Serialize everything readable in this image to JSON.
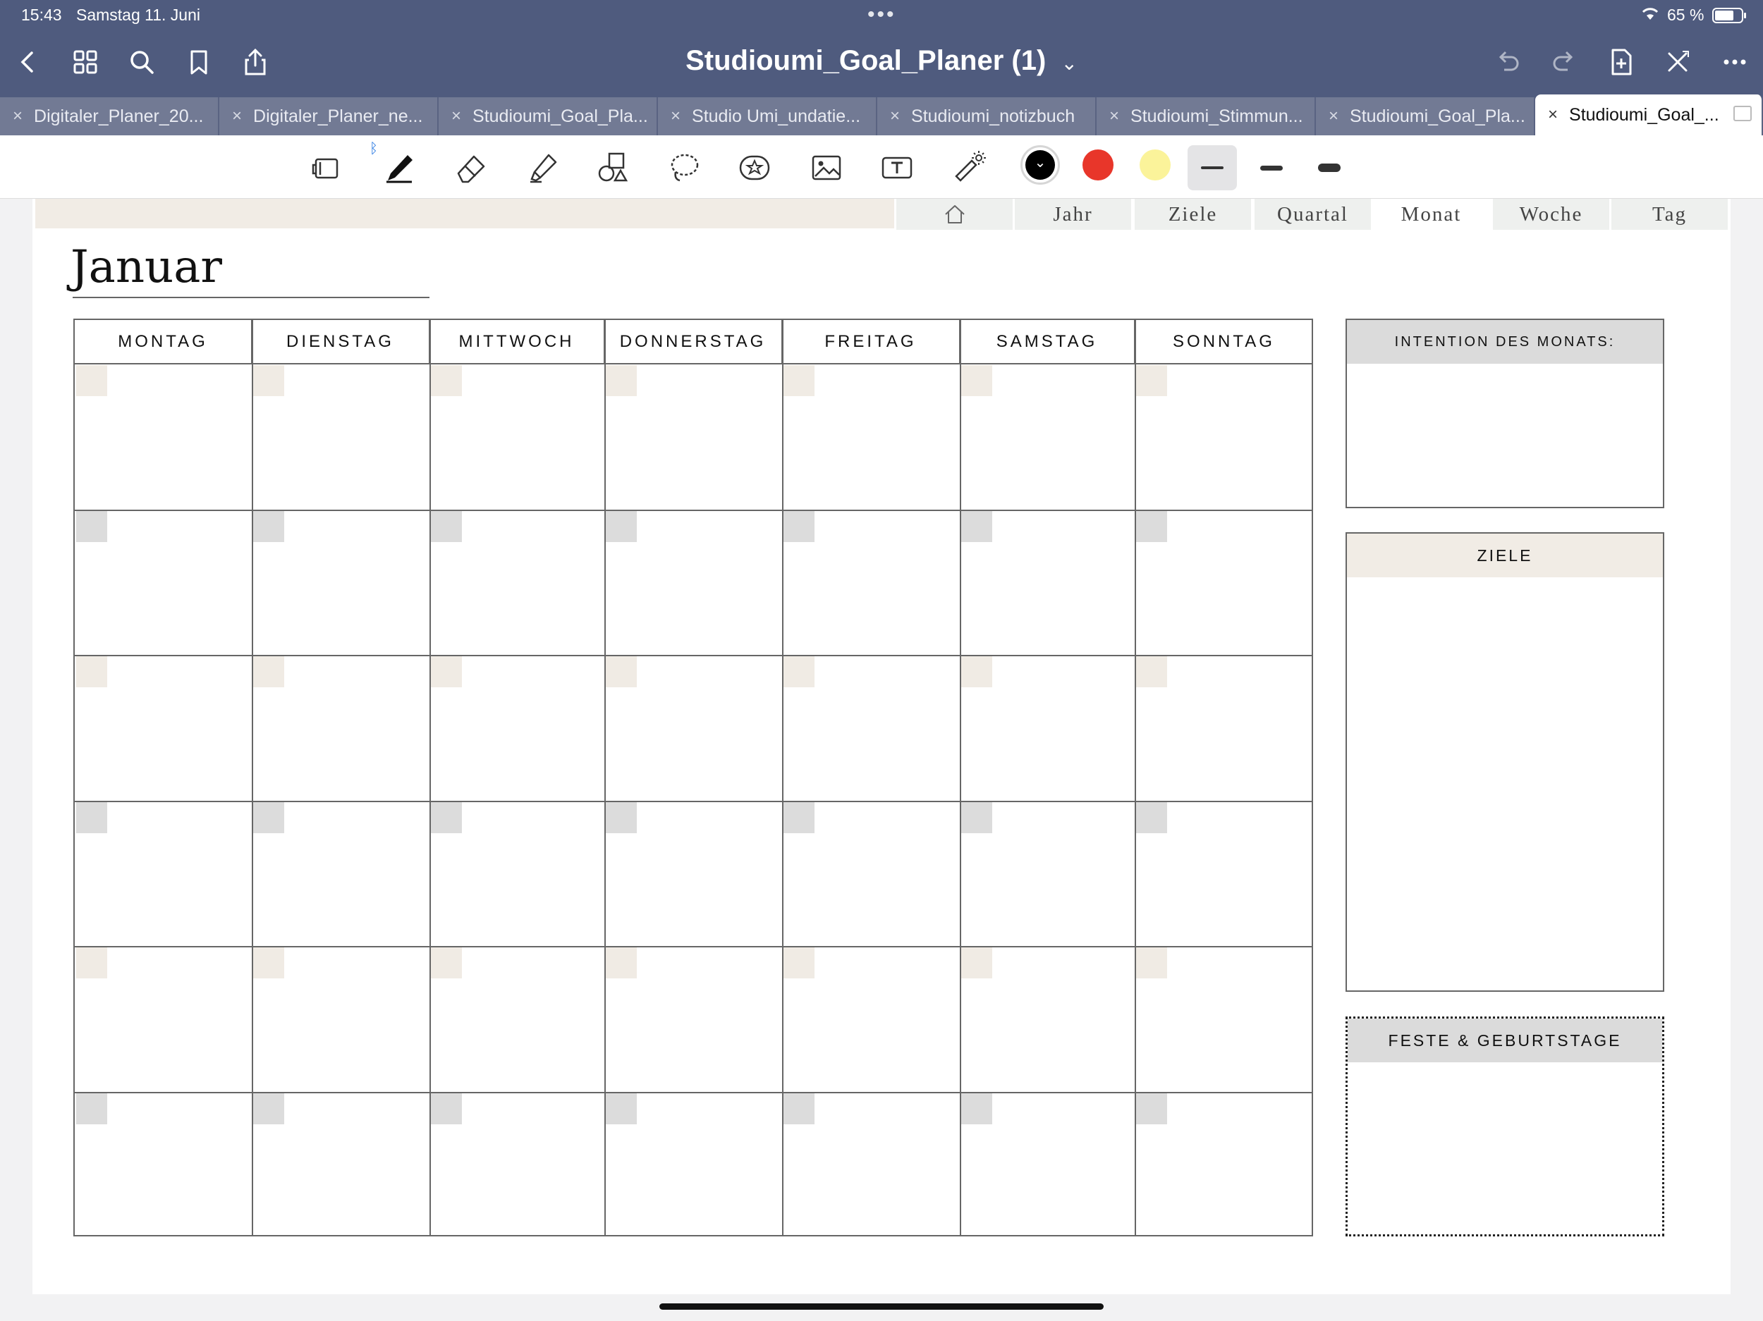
{
  "status_bar": {
    "time": "15:43",
    "date": "Samstag 11. Juni",
    "battery": "65 %"
  },
  "nav": {
    "title": "Studioumi_Goal_Planer (1)",
    "title_caret": "⌄"
  },
  "tabs": [
    {
      "label": "Digitaler_Planer_20..."
    },
    {
      "label": "Digitaler_Planer_ne..."
    },
    {
      "label": "Studioumi_Goal_Pla..."
    },
    {
      "label": "Studio Umi_undatie..."
    },
    {
      "label": "Studioumi_notizbuch"
    },
    {
      "label": "Studioumi_Stimmun..."
    },
    {
      "label": "Studioumi_Goal_Pla..."
    },
    {
      "label": "Studioumi_Goal_..."
    }
  ],
  "tab_close": "×",
  "toolbar": {
    "colors": {
      "black": "#000000",
      "red": "#e8362a",
      "yellow": "#fbf39a"
    },
    "black_chevron": "⌄"
  },
  "planner_nav": {
    "items": [
      "Jahr",
      "Ziele",
      "Quartal",
      "Monat",
      "Woche",
      "Tag"
    ],
    "active": "Monat"
  },
  "month": "Januar",
  "weekdays": [
    "MONTAG",
    "DIENSTAG",
    "MITTWOCH",
    "DONNERSTAG",
    "FREITAG",
    "SAMSTAG",
    "SONNTAG"
  ],
  "boxes": {
    "intention": "INTENTION DES MONATS:",
    "goals": "ZIELE",
    "holidays": "FESTE & GEBURTSTAGE"
  }
}
